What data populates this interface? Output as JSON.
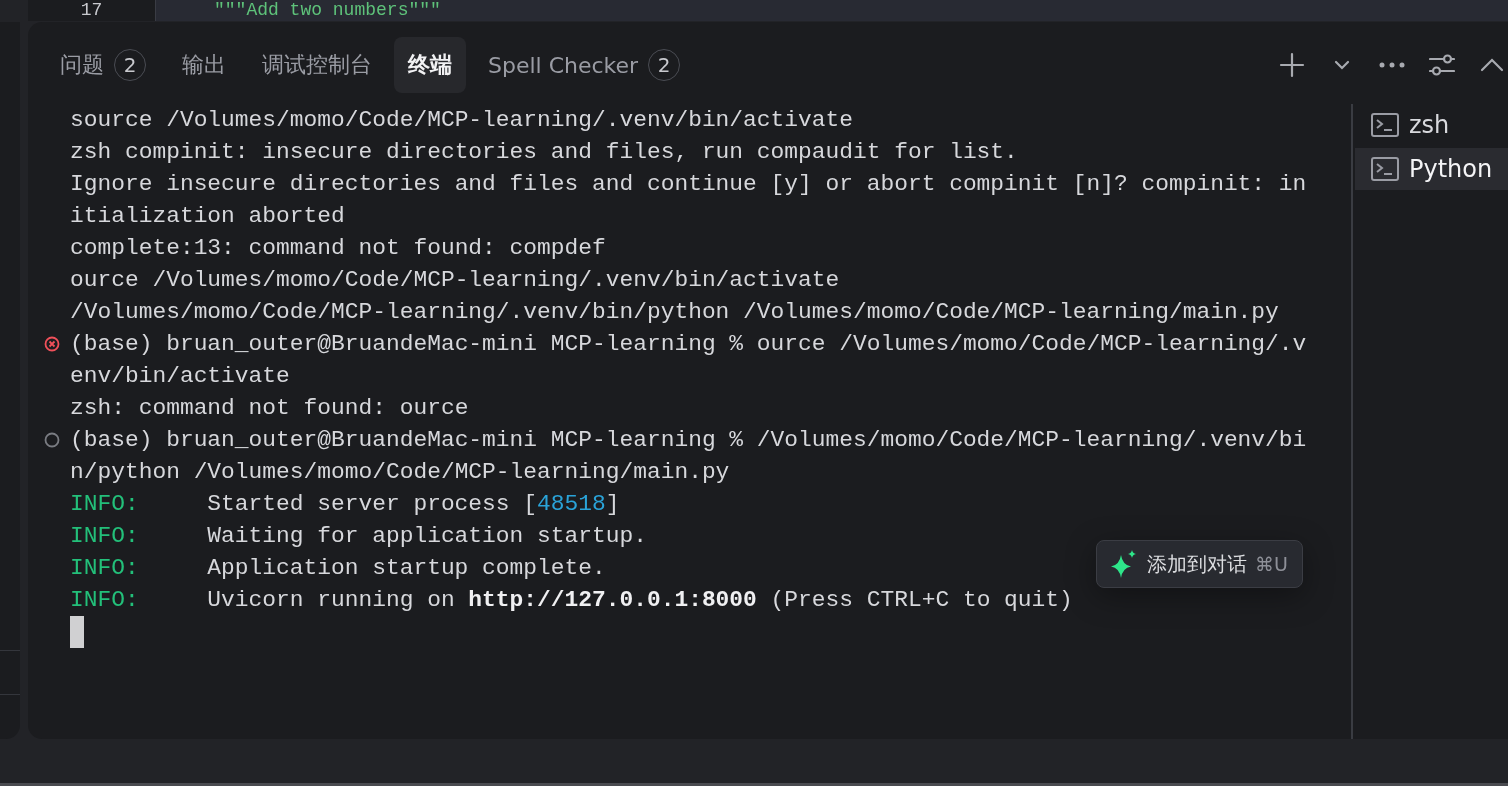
{
  "editor": {
    "line_number": "17",
    "code": "\"\"\"Add two numbers\"\"\""
  },
  "tabs": [
    {
      "label": "问题",
      "badge": "2",
      "selected": false
    },
    {
      "label": "输出",
      "selected": false
    },
    {
      "label": "调试控制台",
      "selected": false
    },
    {
      "label": "终端",
      "selected": true
    },
    {
      "label": "Spell Checker",
      "badge": "2",
      "selected": false
    }
  ],
  "toolbar": [
    {
      "kind": "plus"
    },
    {
      "kind": "chevron-down"
    },
    {
      "kind": "more"
    },
    {
      "kind": "sliders"
    },
    {
      "kind": "chevron-up"
    }
  ],
  "terminal": {
    "lines": [
      {
        "kind": "output",
        "segments": [
          {
            "kind": "text",
            "text": "source /Volumes/momo/Code/MCP-learning/.venv/bin/activate"
          }
        ]
      },
      {
        "kind": "output",
        "segments": [
          {
            "kind": "text",
            "text": "zsh compinit: insecure directories and files, run compaudit for list."
          }
        ]
      },
      {
        "kind": "output",
        "segments": [
          {
            "kind": "text",
            "text": "Ignore insecure directories and files and continue [y] or abort compinit [n]? compinit: in"
          }
        ]
      },
      {
        "kind": "output",
        "segments": [
          {
            "kind": "text",
            "text": "itialization aborted"
          }
        ]
      },
      {
        "kind": "output",
        "segments": [
          {
            "kind": "text",
            "text": "complete:13: command not found: compdef"
          }
        ]
      },
      {
        "kind": "output",
        "segments": [
          {
            "kind": "text",
            "text": "ource /Volumes/momo/Code/MCP-learning/.venv/bin/activate"
          }
        ]
      },
      {
        "kind": "output",
        "segments": [
          {
            "kind": "text",
            "text": "/Volumes/momo/Code/MCP-learning/.venv/bin/python /Volumes/momo/Code/MCP-learning/main.py"
          }
        ]
      },
      {
        "kind": "error-prompt",
        "segments": [
          {
            "kind": "text",
            "text": "(base) bruan_outer@BruandeMac-mini MCP-learning % ource /Volumes/momo/Code/MCP-learning/.v"
          }
        ]
      },
      {
        "kind": "output",
        "segments": [
          {
            "kind": "text",
            "text": "env/bin/activate"
          }
        ]
      },
      {
        "kind": "output",
        "segments": [
          {
            "kind": "text",
            "text": "zsh: command not found: ource"
          }
        ]
      },
      {
        "kind": "prompt",
        "segments": [
          {
            "kind": "text",
            "text": "(base) bruan_outer@BruandeMac-mini MCP-learning % /Volumes/momo/Code/MCP-learning/.venv/bi"
          }
        ]
      },
      {
        "kind": "output",
        "segments": [
          {
            "kind": "text",
            "text": "n/python /Volumes/momo/Code/MCP-learning/main.py"
          }
        ]
      },
      {
        "kind": "output",
        "segments": [
          {
            "kind": "info",
            "text": "INFO:"
          },
          {
            "kind": "text",
            "text": "Started server process ["
          },
          {
            "kind": "number",
            "text": "48518"
          },
          {
            "kind": "text",
            "text": "]"
          }
        ]
      },
      {
        "kind": "output",
        "segments": [
          {
            "kind": "info",
            "text": "INFO:"
          },
          {
            "kind": "text",
            "text": "Waiting for application startup."
          }
        ]
      },
      {
        "kind": "output",
        "segments": [
          {
            "kind": "info",
            "text": "INFO:"
          },
          {
            "kind": "text",
            "text": "Application startup complete."
          }
        ]
      },
      {
        "kind": "output",
        "segments": [
          {
            "kind": "info",
            "text": "INFO:"
          },
          {
            "kind": "text",
            "text": "Uvicorn running on **http://127.0.0.1:8000** (Press CTRL+C to quit)"
          }
        ]
      }
    ],
    "cursor_visible": true
  },
  "sessions": [
    {
      "name": "zsh",
      "selected": false
    },
    {
      "name": "Python",
      "selected": true
    }
  ],
  "tooltip": {
    "label": "添加到对话",
    "shortcut": "⌘U"
  }
}
